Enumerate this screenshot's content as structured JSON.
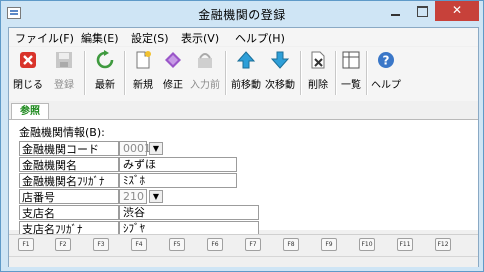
{
  "window": {
    "title": "金融機関の登録",
    "close_glyph": "✕"
  },
  "menu": [
    {
      "label": "ファイル(F)"
    },
    {
      "label": "編集(E)"
    },
    {
      "label": "設定(S)"
    },
    {
      "label": "表示(V)"
    },
    {
      "label": "ヘルプ(H)"
    }
  ],
  "toolbar": [
    {
      "label": "閉じる",
      "icon": "close-icon",
      "enabled": true
    },
    {
      "label": "登録",
      "icon": "save-icon",
      "enabled": false
    },
    {
      "label": "最新",
      "icon": "refresh-icon",
      "enabled": true
    },
    {
      "label": "新規",
      "icon": "new-document-icon",
      "enabled": true
    },
    {
      "label": "修正",
      "icon": "edit-icon",
      "enabled": true
    },
    {
      "label": "入力前",
      "icon": "undo-icon",
      "enabled": false
    },
    {
      "label": "前移動",
      "icon": "arrow-up-icon",
      "enabled": true
    },
    {
      "label": "次移動",
      "icon": "arrow-down-icon",
      "enabled": true
    },
    {
      "label": "削除",
      "icon": "delete-icon",
      "enabled": true
    },
    {
      "label": "一覧",
      "icon": "list-icon",
      "enabled": true
    },
    {
      "label": "ヘルプ",
      "icon": "help-icon",
      "enabled": true
    }
  ],
  "tab": {
    "label": "参照"
  },
  "form": {
    "section_label": "金融機関情報(B):",
    "rows": [
      {
        "label": "金融機関コード",
        "value": "0001"
      },
      {
        "label": "金融機関名",
        "value": "みずほ"
      },
      {
        "label": "金融機関名ﾌﾘｶﾞﾅ",
        "value": "ﾐｽﾞﾎ"
      },
      {
        "label": "店番号",
        "value": "210"
      },
      {
        "label": "支店名",
        "value": "渋谷"
      },
      {
        "label": "支店名ﾌﾘｶﾞﾅ",
        "value": "ｼﾌﾞﾔ"
      }
    ]
  },
  "function_keys": [
    "F1",
    "F2",
    "F3",
    "F4",
    "F5",
    "F6",
    "F7",
    "F8",
    "F9",
    "F10",
    "F11",
    "F12"
  ],
  "colors": {
    "accent_tab": "#1f8a1f",
    "close_button": "#c7413a",
    "window_frame": "#7fb7de"
  }
}
